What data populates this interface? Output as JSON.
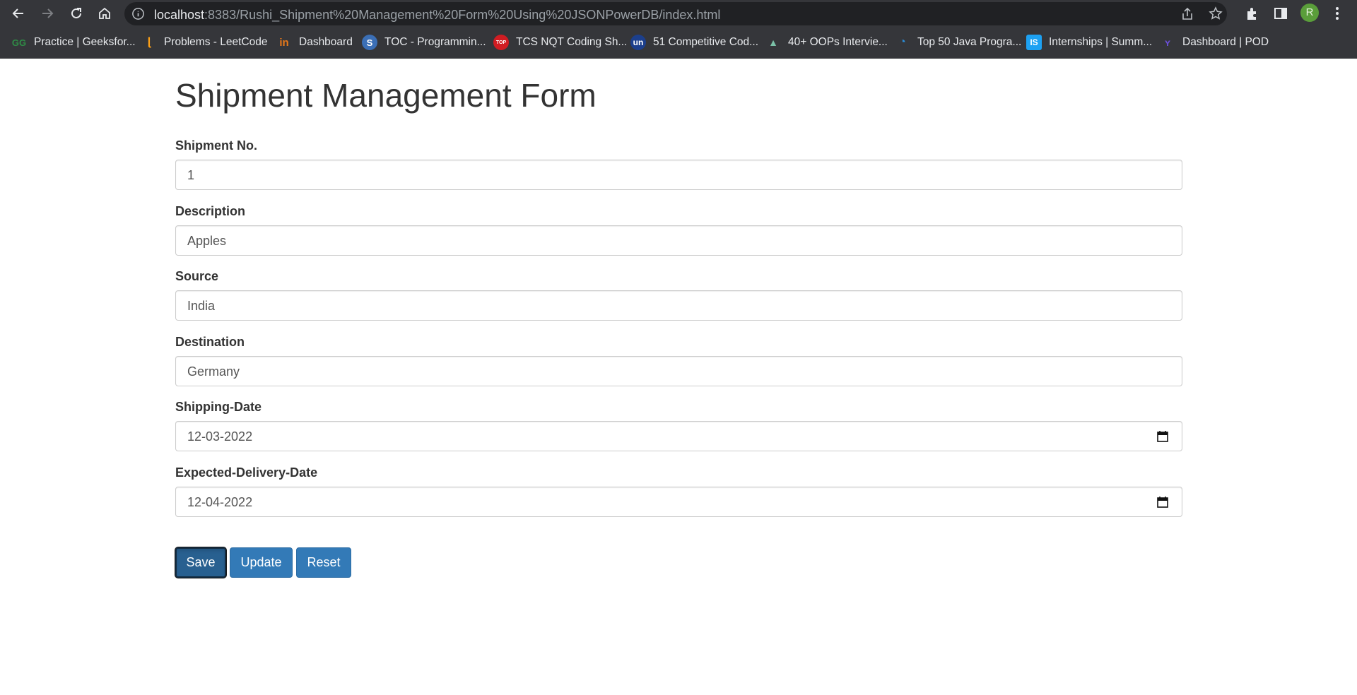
{
  "browser": {
    "url_host": "localhost",
    "url_rest": ":8383/Rushi_Shipment%20Management%20Form%20Using%20JSONPowerDB/index.html",
    "avatar_letter": "R",
    "bookmarks": [
      {
        "label": "Practice | Geeksfor...",
        "icon": "geeksforgeeks-icon"
      },
      {
        "label": "Problems - LeetCode",
        "icon": "leetcode-icon"
      },
      {
        "label": "Dashboard",
        "icon": "dashboard-icon"
      },
      {
        "label": "TOC - Programmin...",
        "icon": "toc-icon"
      },
      {
        "label": "TCS NQT Coding Sh...",
        "icon": "tcs-icon"
      },
      {
        "label": "51 Competitive Cod...",
        "icon": "unstop-icon"
      },
      {
        "label": "40+ OOPs Intervie...",
        "icon": "oops-icon"
      },
      {
        "label": "Top 50 Java Progra...",
        "icon": "java-icon"
      },
      {
        "label": "Internships | Summ...",
        "icon": "internshala-icon"
      },
      {
        "label": "Dashboard | POD",
        "icon": "pod-icon"
      }
    ]
  },
  "form": {
    "title": "Shipment Management Form",
    "fields": [
      {
        "label": "Shipment No.",
        "value": "1"
      },
      {
        "label": "Description",
        "value": "Apples"
      },
      {
        "label": "Source",
        "value": "India"
      },
      {
        "label": "Destination",
        "value": "Germany"
      },
      {
        "label": "Shipping-Date",
        "value": "12-03-2022"
      },
      {
        "label": "Expected-Delivery-Date",
        "value": "12-04-2022"
      }
    ],
    "buttons": {
      "save": "Save",
      "update": "Update",
      "reset": "Reset"
    },
    "colors": {
      "button": "#337ab7",
      "button_active": "#286090"
    }
  }
}
